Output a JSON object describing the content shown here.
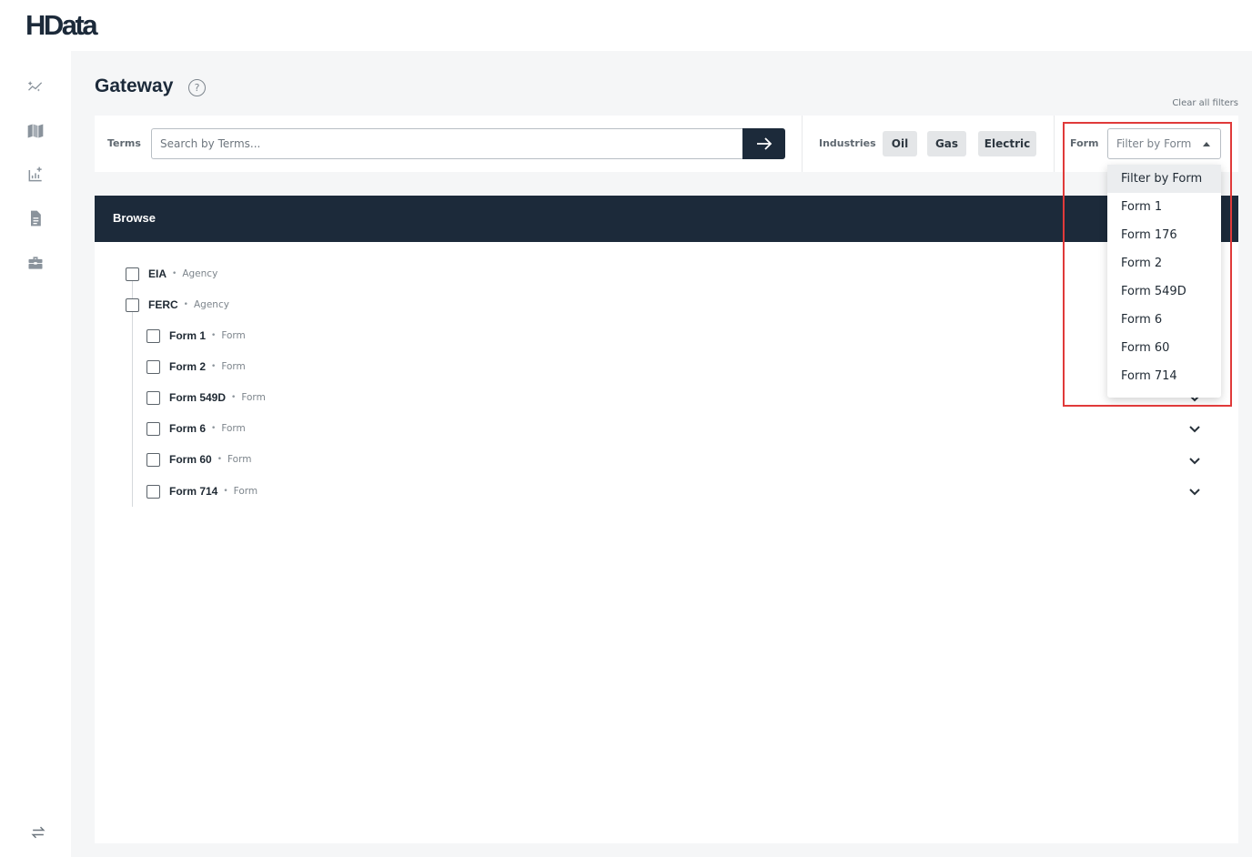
{
  "app": {
    "logo_text": "HData"
  },
  "sidebar": {
    "icons": [
      "sparkle-chart-icon",
      "map-book-icon",
      "add-chart-icon",
      "document-icon",
      "toolbox-icon"
    ],
    "footer_icon": "swap-arrows-icon"
  },
  "page": {
    "title": "Gateway",
    "help_symbol": "?",
    "clear_filters": "Clear all filters"
  },
  "filters": {
    "terms_label": "Terms",
    "terms_placeholder": "Search by Terms...",
    "terms_value": "",
    "industries_label": "Industries",
    "industries": [
      "Oil",
      "Gas",
      "Electric"
    ],
    "form_label": "Form",
    "form_placeholder": "Filter by Form"
  },
  "browse": {
    "title": "Browse",
    "tree": [
      {
        "name": "EIA",
        "type": "Agency"
      },
      {
        "name": "FERC",
        "type": "Agency"
      },
      {
        "name": "Form 1",
        "type": "Form"
      },
      {
        "name": "Form 2",
        "type": "Form"
      },
      {
        "name": "Form 549D",
        "type": "Form"
      },
      {
        "name": "Form 6",
        "type": "Form"
      },
      {
        "name": "Form 60",
        "type": "Form"
      },
      {
        "name": "Form 714",
        "type": "Form"
      }
    ]
  },
  "form_dropdown": {
    "options": [
      "Filter by Form",
      "Form 1",
      "Form 176",
      "Form 2",
      "Form 549D",
      "Form 6",
      "Form 60",
      "Form 714"
    ],
    "selected": "Filter by Form"
  },
  "colors": {
    "navy": "#1c2a3a",
    "highlight": "#e03a3a",
    "background": "#f5f6f7"
  }
}
